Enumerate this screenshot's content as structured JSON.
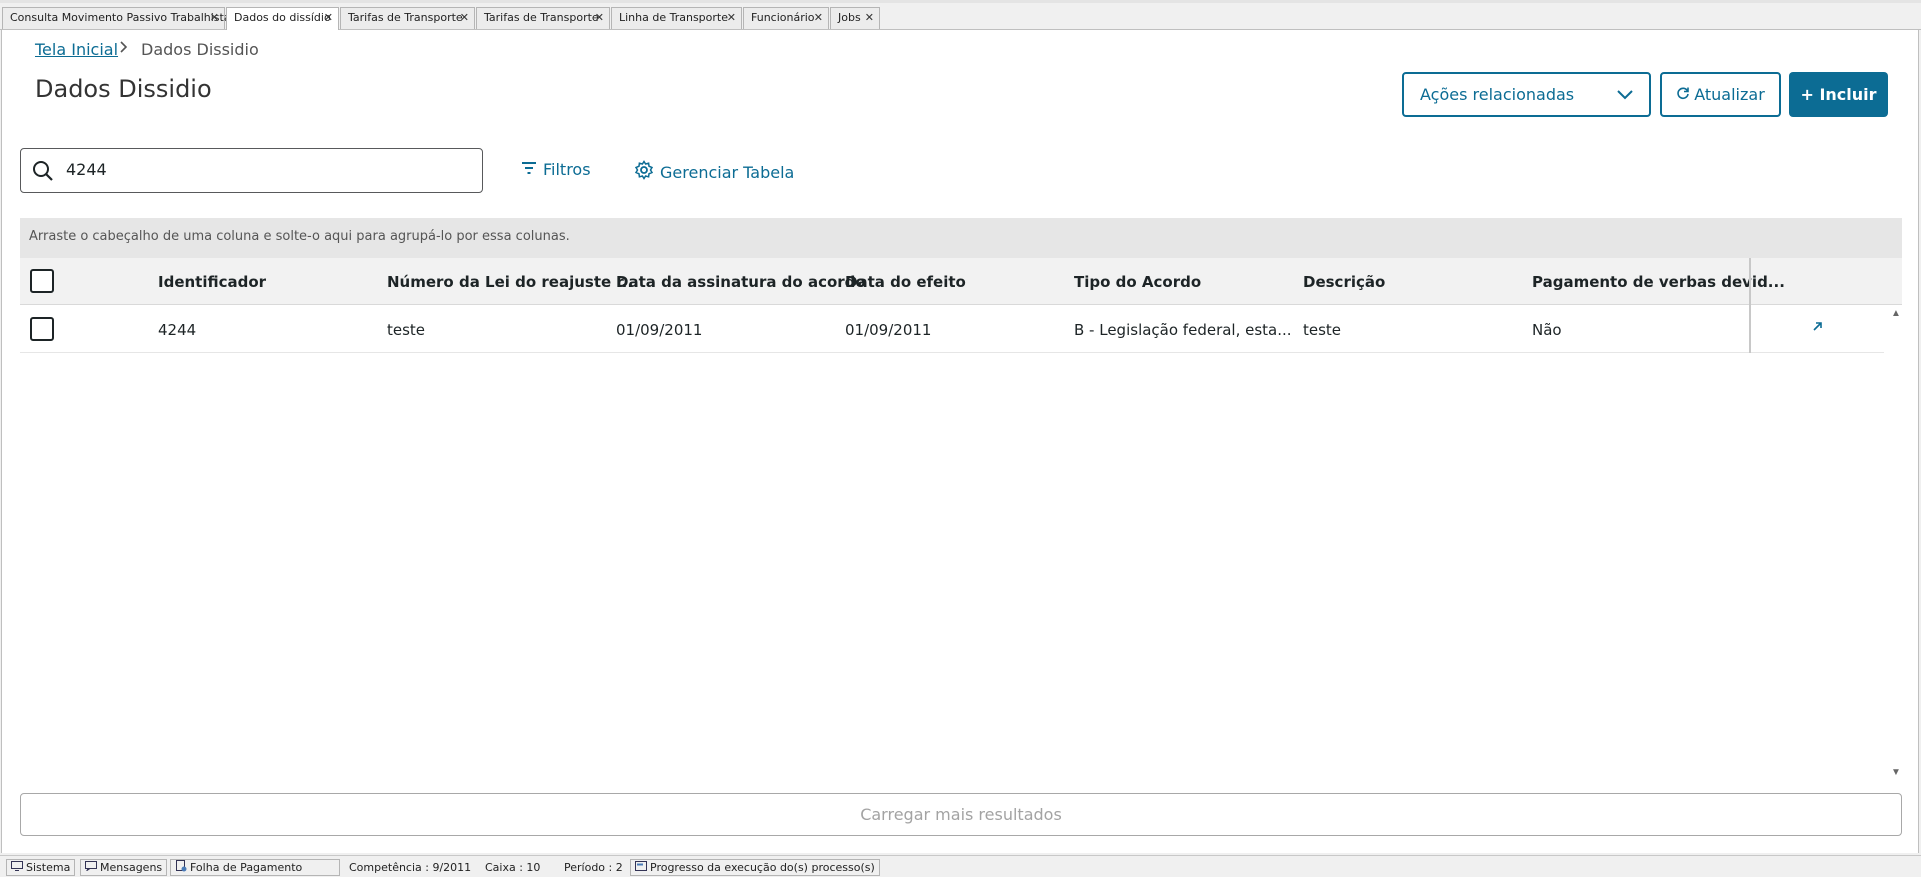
{
  "tabs": [
    {
      "label": "Consulta Movimento Passivo Trabalhista",
      "active": false
    },
    {
      "label": "Dados do dissídio",
      "active": true
    },
    {
      "label": "Tarifas de Transporte",
      "active": false
    },
    {
      "label": "Tarifas de Transporte",
      "active": false
    },
    {
      "label": "Linha de Transporte",
      "active": false
    },
    {
      "label": "Funcionário",
      "active": false
    },
    {
      "label": "Jobs",
      "active": false
    }
  ],
  "breadcrumb": {
    "home": "Tela Inicial",
    "current": "Dados Dissidio"
  },
  "page_title": "Dados Dissidio",
  "actions": {
    "related": "Ações relacionadas",
    "refresh": "Atualizar",
    "include": "+ Incluir"
  },
  "search": {
    "value": "4244"
  },
  "toolbar": {
    "filters": "Filtros",
    "manage_table": "Gerenciar Tabela"
  },
  "group_hint": "Arraste o cabeçalho de uma coluna e solte-o aqui para agrupá-lo por essa colunas.",
  "table": {
    "headers": [
      "Identificador",
      "Número da Lei do reajuste r...",
      "Data da assinatura do acordo",
      "Data do efeito",
      "Tipo do Acordo",
      "Descrição",
      "Pagamento de verbas devid..."
    ],
    "rows": [
      [
        "4244",
        "teste",
        "01/09/2011",
        "01/09/2011",
        "B - Legislação federal, esta...",
        "teste",
        "Não"
      ]
    ]
  },
  "load_more": "Carregar mais resultados",
  "status_bar": {
    "sistema": "Sistema",
    "mensagens": "Mensagens",
    "folha": "Folha de Pagamento",
    "competencia": "Competência : 9/2011",
    "caixa": "Caixa : 10",
    "periodo": "Período : 2",
    "progresso": "Progresso da execução do(s) processo(s)"
  },
  "colors": {
    "accent": "#0c6c94"
  }
}
